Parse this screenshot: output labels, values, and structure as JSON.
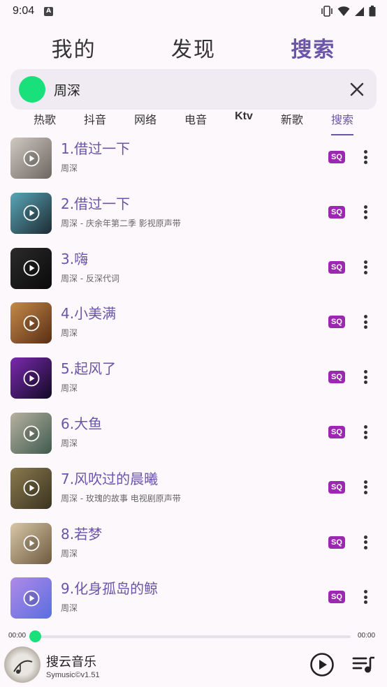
{
  "status_bar": {
    "time": "9:04",
    "notification_letter": "A"
  },
  "top_tabs": [
    {
      "label": "我的",
      "active": false
    },
    {
      "label": "发现",
      "active": false
    },
    {
      "label": "搜索",
      "active": true
    }
  ],
  "search": {
    "value": "周深"
  },
  "category_tabs": [
    {
      "label": "热歌",
      "bold": false,
      "active": false
    },
    {
      "label": "抖音",
      "bold": false,
      "active": false
    },
    {
      "label": "网络",
      "bold": false,
      "active": false
    },
    {
      "label": "电音",
      "bold": false,
      "active": false
    },
    {
      "label": "Ktv",
      "bold": true,
      "active": false
    },
    {
      "label": "新歌",
      "bold": false,
      "active": false
    },
    {
      "label": "搜索",
      "bold": false,
      "active": true
    }
  ],
  "songs": [
    {
      "title": "1.借过一下",
      "subtitle": "周深",
      "badge": "SQ",
      "cover_colors": [
        "#cfc9c2",
        "#6d6660"
      ]
    },
    {
      "title": "2.借过一下",
      "subtitle": "周深 - 庆余年第二季 影视原声带",
      "badge": "SQ",
      "cover_colors": [
        "#5aa6b8",
        "#1d2b33"
      ]
    },
    {
      "title": "3.嗨",
      "subtitle": "周深 - 反深代词",
      "badge": "SQ",
      "cover_colors": [
        "#2b2b2b",
        "#0a0a0a"
      ]
    },
    {
      "title": "4.小美满",
      "subtitle": "周深",
      "badge": "SQ",
      "cover_colors": [
        "#c58a4a",
        "#5a2e14"
      ]
    },
    {
      "title": "5.起风了",
      "subtitle": "周深",
      "badge": "SQ",
      "cover_colors": [
        "#7a2ab0",
        "#120a24"
      ]
    },
    {
      "title": "6.大鱼",
      "subtitle": "周深",
      "badge": "SQ",
      "cover_colors": [
        "#b7b2a1",
        "#3f5a4d"
      ]
    },
    {
      "title": "7.风吹过的晨曦",
      "subtitle": "周深 - 玫瑰的故事 电视剧原声带",
      "badge": "SQ",
      "cover_colors": [
        "#8a7a4e",
        "#3a3320"
      ]
    },
    {
      "title": "8.若梦",
      "subtitle": "周深",
      "badge": "SQ",
      "cover_colors": [
        "#d9c7a8",
        "#6e5a3e"
      ]
    },
    {
      "title": "9.化身孤岛的鲸",
      "subtitle": "周深",
      "badge": "SQ",
      "cover_colors": [
        "#b08ae8",
        "#5a6ee0"
      ]
    }
  ],
  "player": {
    "time_current": "00:00",
    "time_total": "00:00",
    "progress": 0,
    "title": "搜云音乐",
    "subtitle": "Symusic©v1.51"
  },
  "colors": {
    "accent": "#6a55a8",
    "green": "#19e07a",
    "badge": "#9c27b0"
  }
}
